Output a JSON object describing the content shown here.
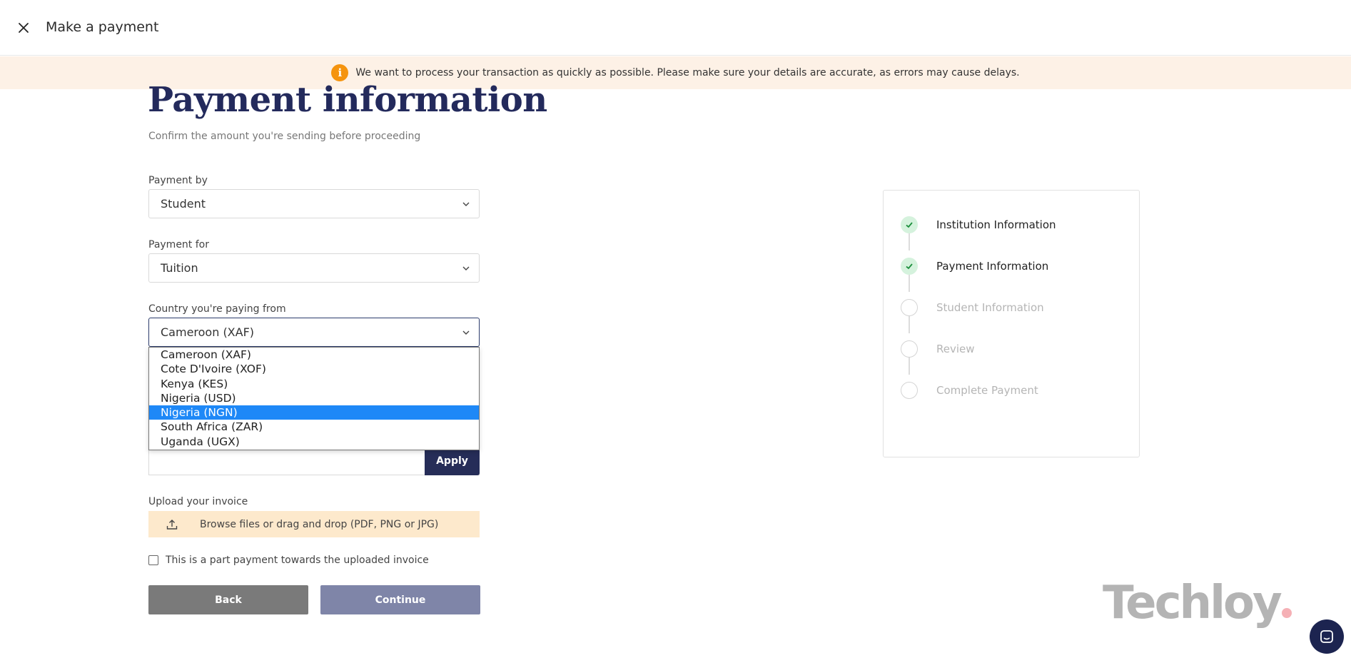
{
  "topbar": {
    "title": "Make a payment"
  },
  "banner": {
    "text": "We want to process your transaction as quickly as possible. Please make sure your details are accurate, as errors may cause delays."
  },
  "page": {
    "title": "Payment information",
    "subtitle": "Confirm the amount you're sending before proceeding"
  },
  "form": {
    "payment_by": {
      "label": "Payment by",
      "value": "Student"
    },
    "payment_for": {
      "label": "Payment for",
      "value": "Tuition"
    },
    "country": {
      "label": "Country you're paying from",
      "value": "Cameroon (XAF)",
      "options": [
        "Cameroon (XAF)",
        "Cote D'Ivoire (XOF)",
        "Kenya (KES)",
        "Nigeria (USD)",
        "Nigeria (NGN)",
        "South Africa (ZAR)",
        "Uganda (UGX)"
      ],
      "highlighted": "Nigeria (NGN)"
    },
    "apply_label": "Apply",
    "upload": {
      "label": "Upload your invoice",
      "text": "Browse files or drag and drop (PDF, PNG or JPG)"
    },
    "part_payment_label": "This is a part payment towards the uploaded invoice",
    "back_label": "Back",
    "continue_label": "Continue"
  },
  "steps": [
    {
      "label": "Institution Information",
      "status": "done"
    },
    {
      "label": "Payment Information",
      "status": "done"
    },
    {
      "label": "Student Information",
      "status": "todo"
    },
    {
      "label": "Review",
      "status": "todo"
    },
    {
      "label": "Complete Payment",
      "status": "todo"
    }
  ],
  "watermark": {
    "text": "Techloy"
  },
  "colors": {
    "brand_navy": "#262d58",
    "banner_bg": "#fdf1e6",
    "info_orange": "#f5940f",
    "upload_bg": "#fde9cc",
    "highlight_blue": "#1e88f7",
    "step_done_green": "#d5f2dd"
  }
}
